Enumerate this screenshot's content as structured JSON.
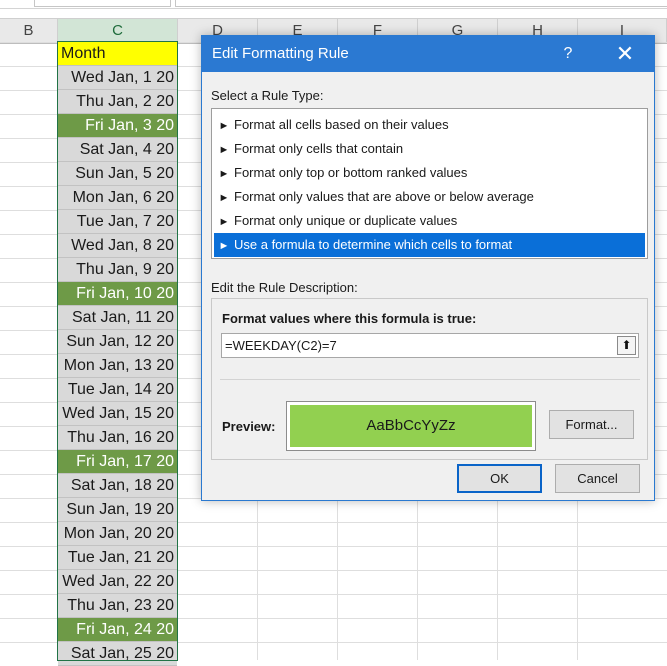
{
  "spreadsheet": {
    "columns": [
      "B",
      "C",
      "D",
      "E",
      "F",
      "G",
      "H",
      "I"
    ],
    "selected_column": "C",
    "rows": [
      {
        "text": "Month",
        "kind": "head"
      },
      {
        "text": "Wed Jan, 1 20",
        "kind": "normal"
      },
      {
        "text": "Thu Jan, 2 20",
        "kind": "normal"
      },
      {
        "text": "Fri Jan, 3 20",
        "kind": "fri"
      },
      {
        "text": "Sat Jan, 4 20",
        "kind": "normal"
      },
      {
        "text": "Sun Jan, 5 20",
        "kind": "normal"
      },
      {
        "text": "Mon Jan, 6 20",
        "kind": "normal"
      },
      {
        "text": "Tue Jan, 7 20",
        "kind": "normal"
      },
      {
        "text": "Wed Jan, 8 20",
        "kind": "normal"
      },
      {
        "text": "Thu Jan, 9 20",
        "kind": "normal"
      },
      {
        "text": "Fri Jan, 10 20",
        "kind": "fri"
      },
      {
        "text": "Sat Jan, 11 20",
        "kind": "normal"
      },
      {
        "text": "Sun Jan, 12 20",
        "kind": "normal"
      },
      {
        "text": "Mon Jan, 13 20",
        "kind": "normal"
      },
      {
        "text": "Tue Jan, 14 20",
        "kind": "normal"
      },
      {
        "text": "Wed Jan, 15 20",
        "kind": "normal"
      },
      {
        "text": "Thu Jan, 16 20",
        "kind": "normal"
      },
      {
        "text": "Fri Jan, 17 20",
        "kind": "fri"
      },
      {
        "text": "Sat Jan, 18 20",
        "kind": "normal"
      },
      {
        "text": "Sun Jan, 19 20",
        "kind": "normal"
      },
      {
        "text": "Mon Jan, 20 20",
        "kind": "normal"
      },
      {
        "text": "Tue Jan, 21 20",
        "kind": "normal"
      },
      {
        "text": "Wed Jan, 22 20",
        "kind": "normal"
      },
      {
        "text": "Thu Jan, 23 20",
        "kind": "normal"
      },
      {
        "text": "Fri Jan, 24 20",
        "kind": "fri"
      },
      {
        "text": "Sat Jan, 25 20",
        "kind": "normal"
      }
    ],
    "colors": {
      "header_fill": "#ffff00",
      "friday_fill": "#6e9a47",
      "normal_fill": "#d9d9d9"
    }
  },
  "dialog": {
    "title": "Edit Formatting Rule",
    "help_label": "?",
    "close_label": "✕",
    "select_rule_label": "Select a Rule Type:",
    "rule_types": [
      {
        "label": "Format all cells based on their values",
        "selected": false
      },
      {
        "label": "Format only cells that contain",
        "selected": false
      },
      {
        "label": "Format only top or bottom ranked values",
        "selected": false
      },
      {
        "label": "Format only values that are above or below average",
        "selected": false
      },
      {
        "label": "Format only unique or duplicate values",
        "selected": false
      },
      {
        "label": "Use a formula to determine which cells to format",
        "selected": true
      }
    ],
    "edit_desc_label": "Edit the Rule Description:",
    "formula_title": "Format values where this formula is true:",
    "formula_value": "=WEEKDAY(C2)=7",
    "preview_label": "Preview:",
    "preview_text": "AaBbCcYyZz",
    "preview_fill": "#92d050",
    "format_button": "Format...",
    "ok_button": "OK",
    "cancel_button": "Cancel"
  }
}
